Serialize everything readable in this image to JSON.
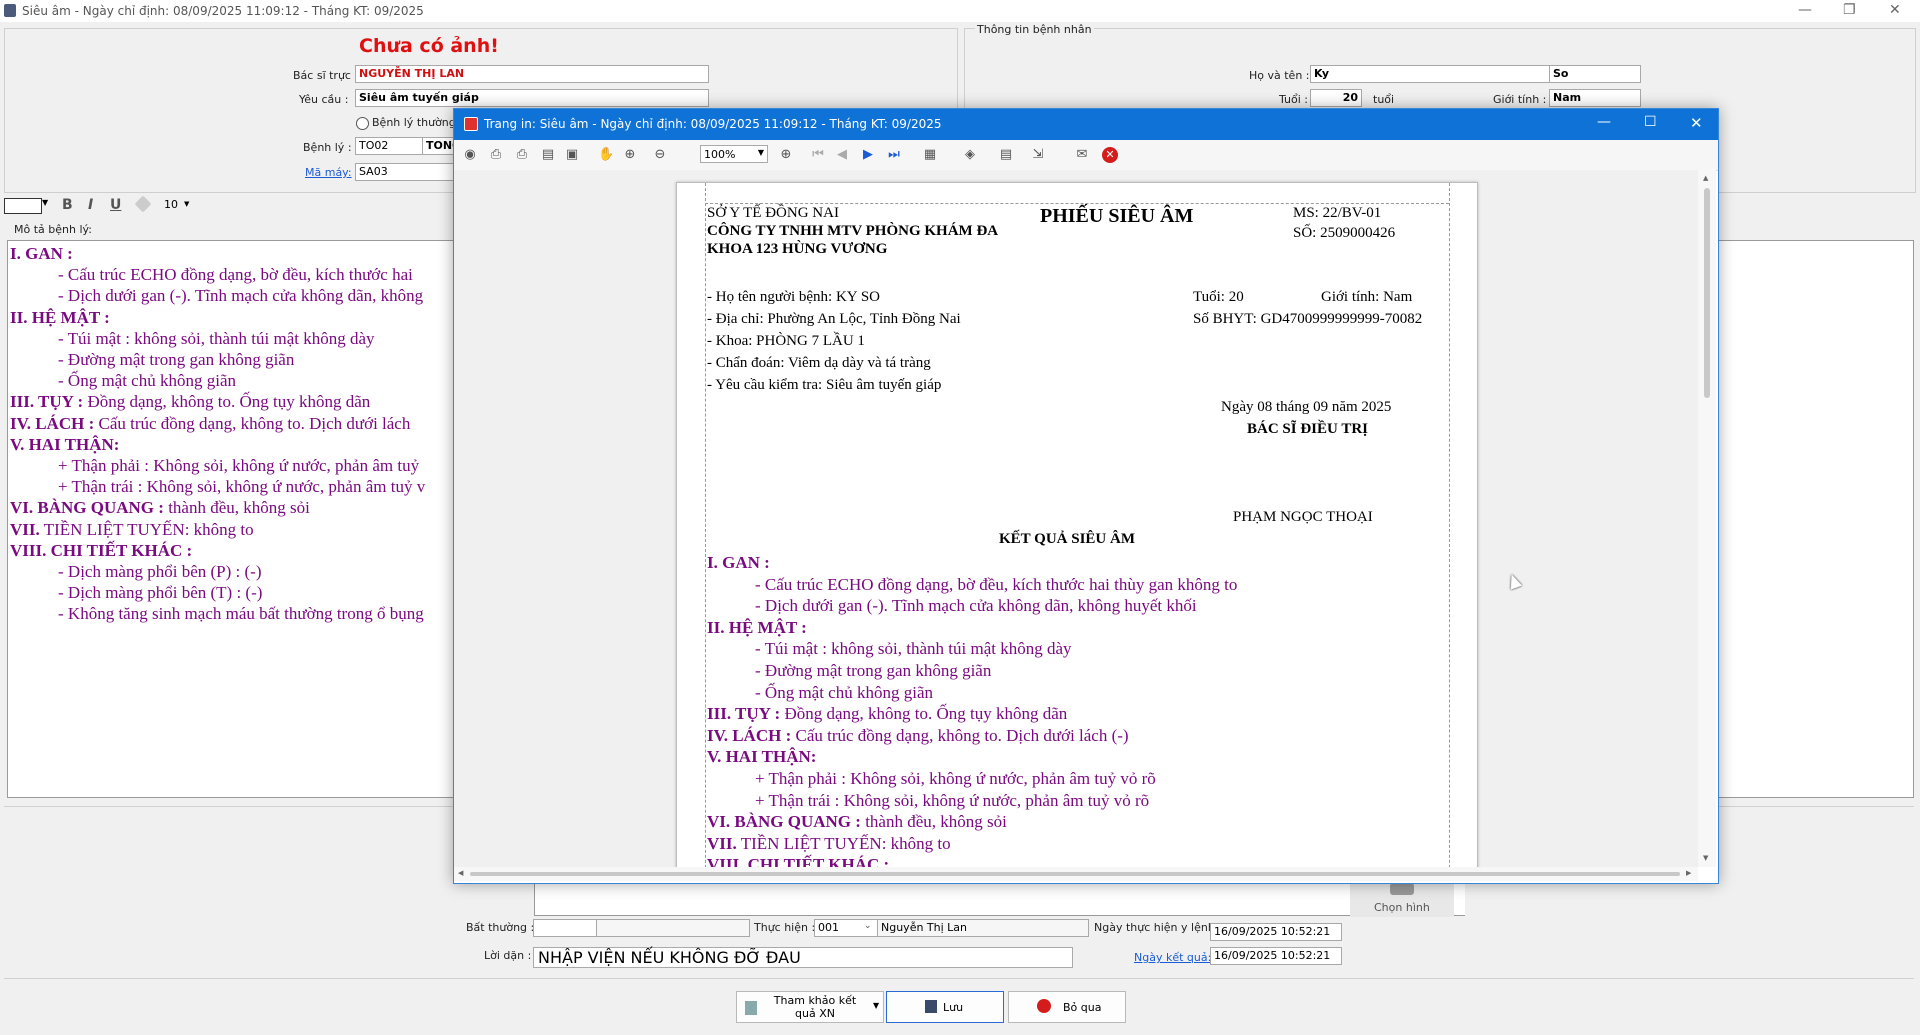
{
  "window": {
    "title": "Siêu âm - Ngày chỉ định: 08/09/2025 11:09:12 - Tháng KT: 09/2025"
  },
  "header": {
    "no_image": "Chưa có ảnh!",
    "doctor_label": "Bác sĩ trực :",
    "doctor_value": "NGUYỄN THỊ LAN",
    "request_label": "Yêu cầu :",
    "request_value": "Siêu âm tuyến giáp",
    "normal_checkbox": "Bệnh lý thường gặ",
    "disease_label": "Bệnh lý :",
    "disease_code": "TO02",
    "disease_name": "TONG",
    "machine_label": "Mã máy:",
    "machine_value": "SA03"
  },
  "patient_info": {
    "group_title": "Thông tin bệnh nhân",
    "name_label": "Họ và tên :",
    "first": "Ky",
    "last": "So",
    "age_label": "Tuổi :",
    "age": "20",
    "age_unit": "tuổi",
    "gender_label": "Giới tính :",
    "gender": "Nam"
  },
  "editor_toolbar": {
    "font_size": "10",
    "bold": "B",
    "italic": "I",
    "underline": "U"
  },
  "editor": {
    "label": "Mô tả bệnh lý:",
    "lines": [
      {
        "b": "I. GAN :",
        "t": ""
      },
      {
        "b": "",
        "t": "- Cấu trúc ECHO đồng dạng, bờ đều, kích thước hai"
      },
      {
        "b": "",
        "t": "- Dịch dưới gan (-). Tĩnh mạch cửa không dãn, không"
      },
      {
        "b": "II. HỆ MẬT :",
        "t": ""
      },
      {
        "b": "",
        "t": "- Túi mật : không sỏi, thành túi mật không dày"
      },
      {
        "b": "",
        "t": "- Đường mật trong gan không giãn"
      },
      {
        "b": "",
        "t": "- Ống mật chủ không giãn"
      },
      {
        "b": "III. TỤY :",
        "t": " Đồng dạng, không to. Ống tụy không dãn"
      },
      {
        "b": "IV. LÁCH :",
        "t": " Cấu trúc đồng dạng, không to. Dịch dưới lách"
      },
      {
        "b": "V. HAI THẬN:",
        "t": ""
      },
      {
        "b": "",
        "t": "+ Thận phải : Không sỏi, không ứ nước, phản âm tuỷ"
      },
      {
        "b": "",
        "t": "+ Thận trái : Không sỏi, không ứ nước, phản âm tuỷ v"
      },
      {
        "b": "VI. BÀNG QUANG :",
        "t": " thành đều, không sỏi"
      },
      {
        "b": "VII.",
        "t": " TIỀN LIỆT TUYẾN: không to"
      },
      {
        "b": "VIII. CHI TIẾT KHÁC :",
        "t": ""
      },
      {
        "b": "",
        "t": "- Dịch màng phổi bên (P) : (-)"
      },
      {
        "b": "",
        "t": "- Dịch màng phổi bên (T) : (-)"
      },
      {
        "b": "",
        "t": "- Không tăng sinh mạch máu bất thường trong ổ bụng"
      }
    ]
  },
  "bottom": {
    "choose_image": "Chọn hình",
    "abnormal_label": "Bất thường :",
    "performer_label": "Thực hiện :",
    "performer_code": "001",
    "performer_name": "Nguyễn Thị Lan",
    "exec_date_label": "Ngày thực hiện y lệnh:",
    "exec_date": "16/09/2025  10:52:21",
    "advice_label": "Lời dặn :",
    "advice_value": "NHẬP VIỆN NẾU KHÔNG ĐỠ ĐAU",
    "result_date_label": "Ngày kết quả:",
    "result_date": "16/09/2025  10:52:21",
    "ref_button": "Tham khảo kết quả XN",
    "save_button": "Lưu",
    "skip_button": "Bỏ qua"
  },
  "dialog": {
    "title": "Trang in: Siêu âm - Ngày chỉ định: 08/09/2025 11:09:12 - Tháng KT: 09/2025",
    "zoom": "100%"
  },
  "report": {
    "dept": "SỞ Y TẾ ĐỒNG NAI",
    "company1": "CÔNG TY TNHH MTV PHÒNG KHÁM ĐA",
    "company2": "KHOA 123 HÙNG VƯƠNG",
    "title": "PHIẾU SIÊU ÂM",
    "ms": "MS: 22/BV-01",
    "so": "SỐ: 2509000426",
    "patient": "- Họ tên người bệnh: KY SO",
    "age": "Tuổi: 20",
    "gender": "Giới tính: Nam",
    "address": "- Địa chỉ: Phường An Lộc, Tỉnh Đồng Nai",
    "bhyt": "Số BHYT: GD4700999999999-70082",
    "khoa": "- Khoa: PHÒNG 7 LẦU 1",
    "diagnosis": "- Chẩn đoán: Viêm dạ dày và tá tràng",
    "request": "- Yêu cầu kiểm tra: Siêu âm tuyến giáp",
    "date": "Ngày 08 tháng 09 năm 2025",
    "sign_title": "BÁC SĨ ĐIỀU TRỊ",
    "sign_name": "PHẠM NGỌC THOẠI",
    "result_title": "KẾT QUẢ SIÊU ÂM",
    "lines": [
      {
        "b": "I. GAN :",
        "t": "",
        "indent": 0
      },
      {
        "b": "",
        "t": "- Cấu trúc ECHO đồng dạng, bờ đều, kích thước hai thùy gan không to",
        "indent": 1
      },
      {
        "b": "",
        "t": "- Dịch dưới gan (-). Tĩnh mạch cửa không dãn, không huyết khối",
        "indent": 1
      },
      {
        "b": "II. HỆ MẬT :",
        "t": "",
        "indent": 0
      },
      {
        "b": "",
        "t": "- Túi mật : không sỏi, thành túi mật không dày",
        "indent": 1
      },
      {
        "b": "",
        "t": "- Đường mật trong gan không giãn",
        "indent": 1
      },
      {
        "b": "",
        "t": "- Ống mật chủ không giãn",
        "indent": 1
      },
      {
        "b": "III. TỤY :",
        "t": " Đồng dạng, không to. Ống tụy không dãn",
        "indent": 0
      },
      {
        "b": "IV. LÁCH :",
        "t": " Cấu trúc đồng dạng, không to. Dịch dưới lách (-)",
        "indent": 0
      },
      {
        "b": "V. HAI THẬN:",
        "t": "",
        "indent": 0
      },
      {
        "b": "",
        "t": "+ Thận phải : Không sỏi, không ứ nước, phản âm tuỷ vỏ rõ",
        "indent": 1
      },
      {
        "b": "",
        "t": "+ Thận trái : Không sỏi, không ứ nước, phản âm tuỷ vỏ rõ",
        "indent": 1
      },
      {
        "b": "VI. BÀNG QUANG :",
        "t": " thành đều, không sỏi",
        "indent": 0
      },
      {
        "b": "VII.",
        "t": " TIỀN LIỆT TUYẾN: không to",
        "indent": 0
      },
      {
        "b": "VIII. CHI TIẾT KHÁC :",
        "t": "",
        "indent": 0
      }
    ]
  }
}
